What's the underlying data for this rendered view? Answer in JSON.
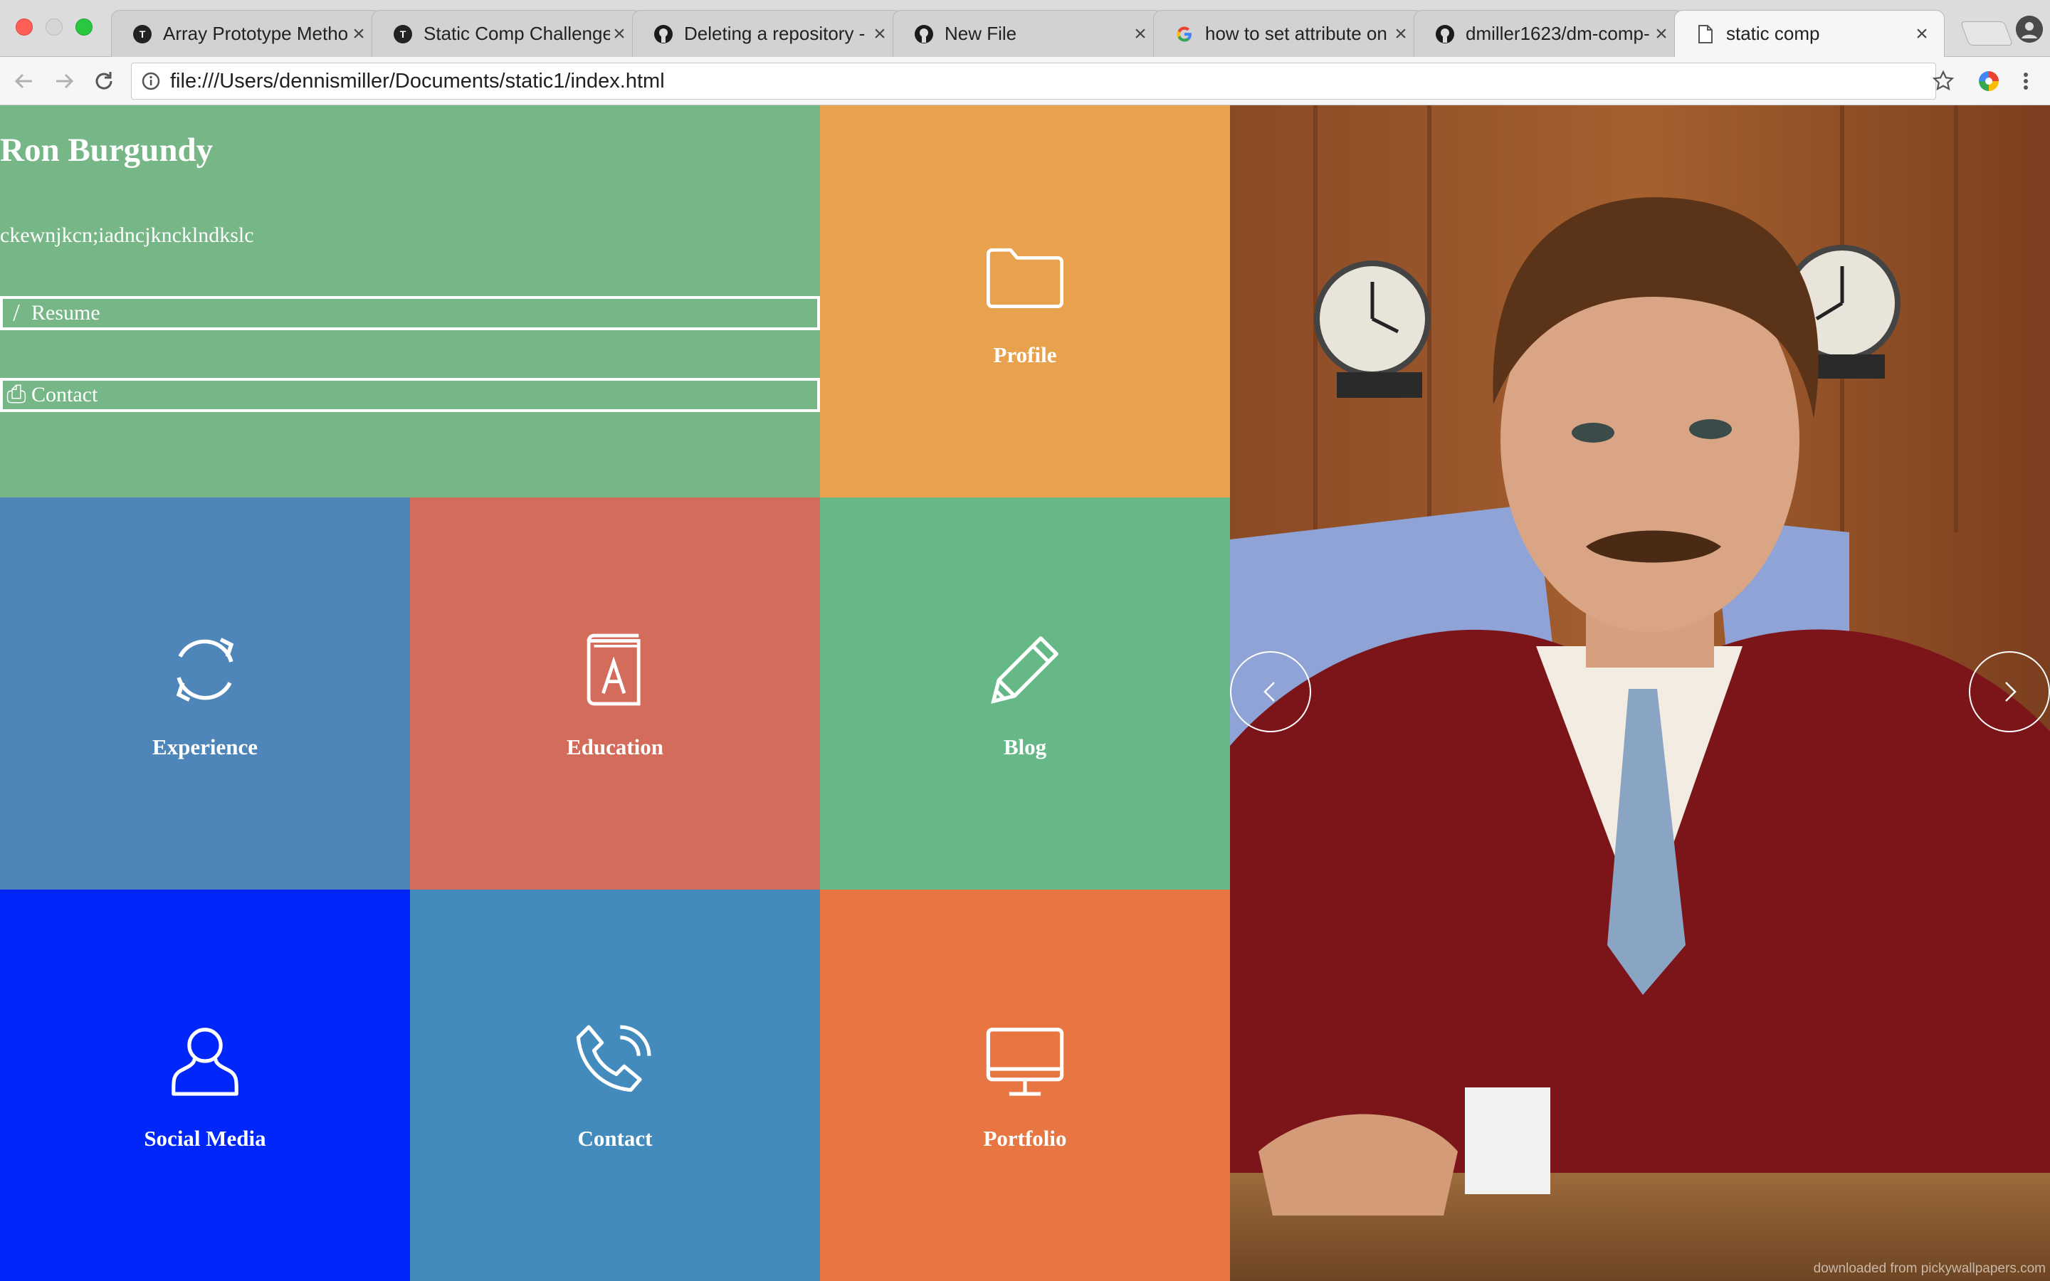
{
  "browser": {
    "tabs": [
      {
        "title": "Array Prototype Metho",
        "favicon": "turing-icon"
      },
      {
        "title": "Static Comp Challenge",
        "favicon": "turing-icon"
      },
      {
        "title": "Deleting a repository -",
        "favicon": "github-icon"
      },
      {
        "title": "New File",
        "favicon": "github-icon"
      },
      {
        "title": "how to set attribute on",
        "favicon": "google-icon"
      },
      {
        "title": "dmiller1623/dm-comp-",
        "favicon": "github-icon"
      },
      {
        "title": "static comp",
        "favicon": "page-icon"
      }
    ],
    "tab_close": "×",
    "url": "file:///Users/dennismiller/Documents/static1/index.html"
  },
  "intro": {
    "name": "Ron Burgundy",
    "tagline": "ckewnjkcn;iadncjkncklndkslc",
    "resume_label": "Resume",
    "resume_icon": "/",
    "contact_label": "Contact",
    "contact_icon": "⎙"
  },
  "tiles": {
    "profile": "Profile",
    "experience": "Experience",
    "education": "Education",
    "blog": "Blog",
    "social": "Social Media",
    "contact": "Contact",
    "portfolio": "Portfolio"
  },
  "colors": {
    "intro": "#77b787",
    "profile": "#e8a24e",
    "experience": "#4f86b9",
    "education": "#d46c5b",
    "blog": "#66b886",
    "social": "#0126f9",
    "contact": "#438abd",
    "portfolio": "#e77643"
  },
  "photo": {
    "credit": "downloaded from pickywallpapers.com"
  }
}
